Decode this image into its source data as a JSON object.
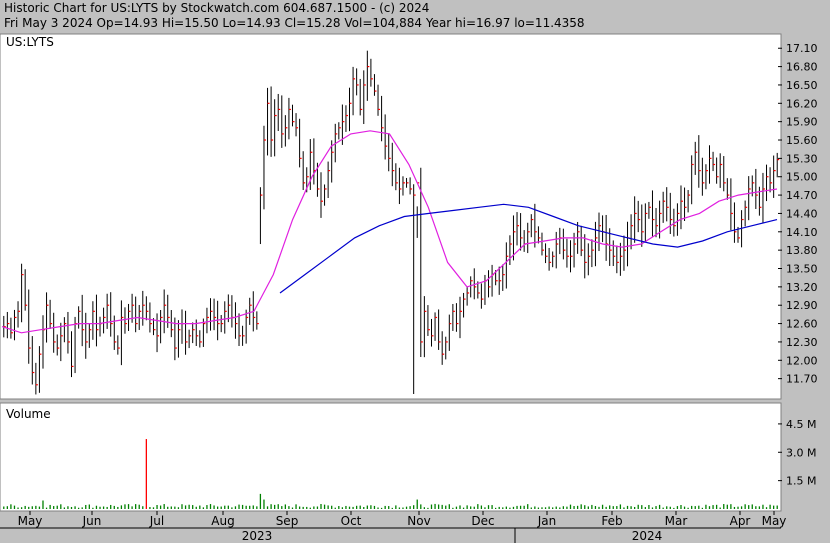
{
  "header": {
    "line1": "Historic Chart for US:LYTS by Stockwatch.com 604.687.1500 - (c) 2024",
    "line2": "Fri May  3 2024  Op=14.93  Hi=15.50  Lo=14.93  Cl=15.28  Vol=104,884  Year hi=16.97  lo=11.4358"
  },
  "price_panel": {
    "label": "US:LYTS"
  },
  "volume_panel": {
    "label": "Volume"
  },
  "colors": {
    "background": "#c0c0c0",
    "panel": "#ffffff",
    "bar": "#000000",
    "close_tick": "#ff0000",
    "ma_short": "#e020e0",
    "ma_long": "#0000cc",
    "volume": "#008000",
    "volume_spike": "#ff0000"
  },
  "chart_data": [
    {
      "type": "ohlc",
      "title": "Historic Chart for US:LYTS by Stockwatch.com 604.687.1500 - (c) 2024",
      "ylim": [
        11.4,
        17.3
      ],
      "yticks": [
        11.7,
        12.0,
        12.3,
        12.6,
        12.9,
        13.2,
        13.5,
        13.8,
        14.1,
        14.4,
        14.7,
        15.0,
        15.3,
        15.6,
        15.9,
        16.2,
        16.5,
        16.8,
        17.1
      ],
      "x_tick_labels": [
        "May",
        "Jun",
        "Jul",
        "Aug",
        "Sep",
        "Oct",
        "Nov",
        "Dec",
        "Jan",
        "Feb",
        "Mar",
        "Apr",
        "May"
      ],
      "year_labels": [
        "2023",
        "2024"
      ],
      "weekly_closes": [
        12.55,
        12.6,
        12.45,
        12.7,
        12.8,
        13.4,
        12.9,
        12.2,
        11.8,
        11.6,
        12.1,
        12.5,
        12.9,
        12.6,
        12.3,
        12.2,
        12.4,
        12.6,
        12.3,
        11.9,
        12.6,
        12.8,
        12.5,
        12.3,
        12.5,
        12.8,
        12.5,
        12.6,
        12.7,
        12.9,
        12.6,
        12.3,
        12.2,
        12.7,
        12.6,
        12.8,
        12.9,
        12.6,
        12.8,
        12.9,
        12.8,
        12.6,
        12.5,
        12.4,
        12.7,
        12.9,
        12.7,
        12.5,
        12.2,
        12.5,
        12.6,
        12.3,
        12.4,
        12.5,
        12.4,
        12.3,
        12.6,
        12.7,
        12.8,
        12.7,
        12.6,
        12.6,
        12.8,
        12.9,
        12.7,
        12.6,
        12.4,
        12.4,
        12.7,
        12.9,
        12.7,
        12.6,
        14.7,
        15.6,
        16.2,
        15.6,
        16.0,
        16.1,
        15.7,
        15.8,
        16.1,
        15.9,
        15.8,
        15.3,
        14.9,
        15.0,
        15.4,
        15.1,
        14.8,
        14.6,
        14.8,
        15.1,
        15.4,
        15.7,
        15.8,
        15.9,
        16.0,
        16.2,
        16.6,
        16.5,
        16.1,
        16.5,
        16.8,
        16.6,
        16.4,
        16.1,
        15.8,
        15.5,
        15.3,
        15.1,
        14.9,
        14.8,
        14.9,
        14.9,
        14.8,
        14.7,
        14.9,
        12.3,
        12.8,
        12.5,
        12.4,
        12.7,
        12.3,
        12.1,
        12.3,
        12.6,
        12.8,
        12.6,
        12.8,
        13.0,
        13.1,
        13.3,
        13.2,
        13.1,
        13.0,
        13.3,
        13.2,
        13.4,
        13.3,
        13.3,
        13.4,
        13.7,
        13.9,
        14.1,
        14.2,
        14.0,
        13.9,
        14.1,
        14.3,
        14.1,
        14.0,
        13.8,
        13.7,
        13.6,
        13.7,
        13.9,
        14.0,
        13.8,
        13.7,
        13.7,
        13.9,
        14.1,
        13.8,
        13.6,
        13.7,
        13.8,
        14.0,
        14.2,
        14.1,
        13.9,
        13.8,
        13.7,
        13.6,
        13.7,
        13.8,
        14.0,
        14.2,
        14.4,
        14.3,
        14.1,
        14.4,
        14.5,
        14.3,
        14.2,
        14.4,
        14.6,
        14.5,
        14.3,
        14.2,
        14.4,
        14.6,
        14.5,
        14.7,
        15.2,
        15.4,
        15.1,
        14.9,
        15.1,
        15.3,
        15.2,
        15.0,
        15.2,
        14.9,
        14.7,
        14.4,
        14.1,
        14.0,
        14.3,
        14.5,
        14.8,
        14.9,
        14.7,
        14.5,
        14.8,
        15.0,
        14.9,
        15.1,
        15.28
      ],
      "series": [],
      "moving_averages": [
        {
          "color": "#e020e0",
          "path": [
            [
              12.55,
              12.45,
              12.5,
              12.55,
              12.6,
              12.6,
              12.65,
              12.7,
              12.65,
              12.6,
              12.6,
              12.65,
              12.7,
              12.8,
              13.4,
              14.3,
              15.0,
              15.5,
              15.7,
              15.75,
              15.7,
              15.2,
              14.5,
              13.6,
              13.2,
              13.3,
              13.6,
              13.9,
              13.95,
              14.0,
              14.0,
              13.9,
              13.85,
              13.9,
              14.1,
              14.3,
              14.4,
              14.6,
              14.7,
              14.75,
              14.8
            ]
          ]
        },
        {
          "color": "#0000cc",
          "path": [
            [
              13.1,
              13.4,
              13.7,
              14.0,
              14.2,
              14.35,
              14.4,
              14.45,
              14.5,
              14.55,
              14.5,
              14.35,
              14.2,
              14.1,
              14.0,
              13.9,
              13.85,
              13.95,
              14.1,
              14.2,
              14.3
            ]
          ]
        }
      ]
    },
    {
      "type": "bar",
      "title": "Volume",
      "yticks": [
        "1.5 M",
        "3.0 M",
        "4.5 M"
      ],
      "ylim": [
        0,
        5.5
      ],
      "unit": "M",
      "peak_value": 3.7,
      "typical_value": 0.15
    }
  ]
}
